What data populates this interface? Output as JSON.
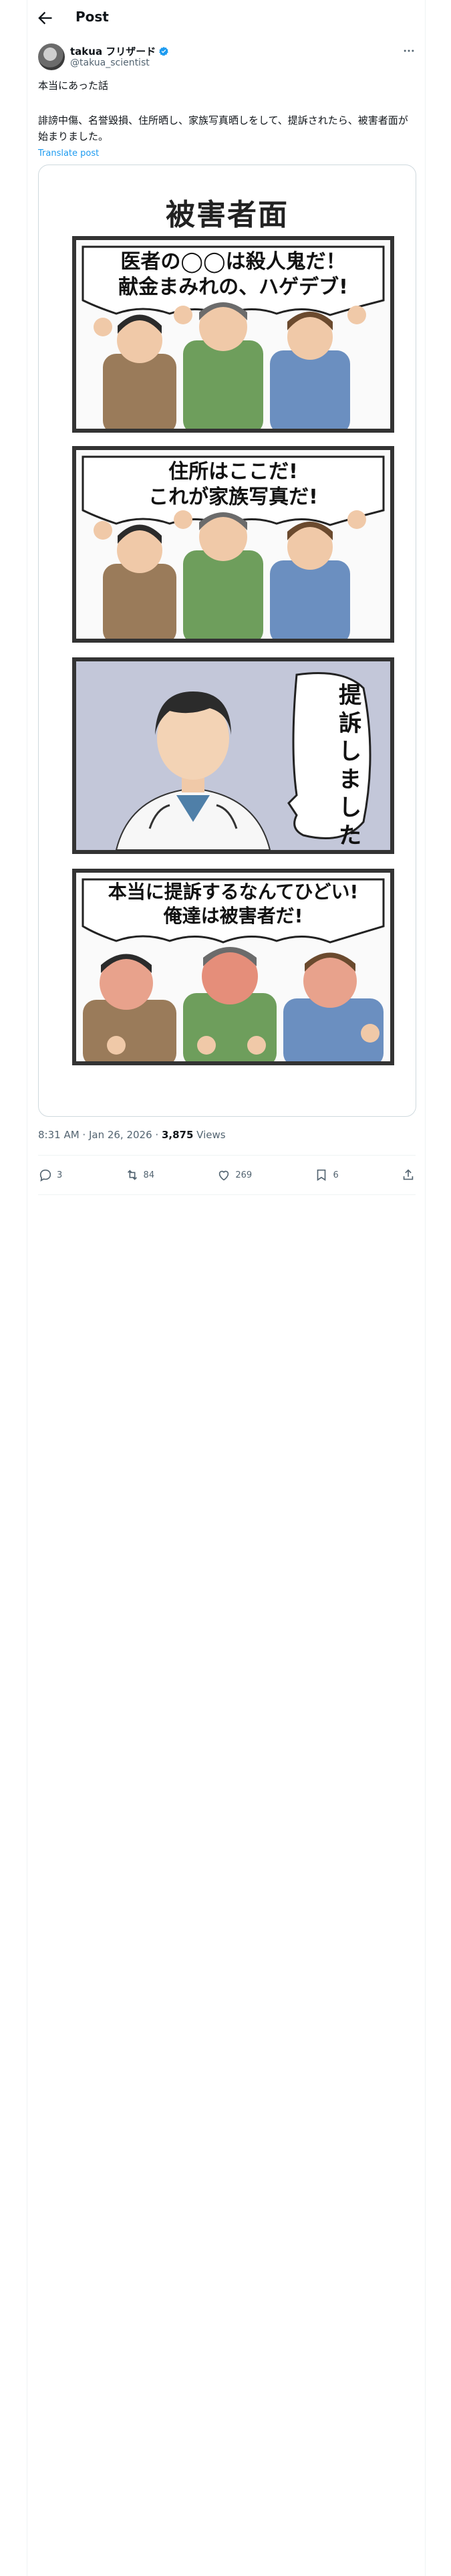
{
  "header": {
    "title": "Post"
  },
  "author": {
    "display_name": "takua フリザード",
    "handle": "@takua_scientist"
  },
  "tweet": {
    "line1": "本当にあった話",
    "line2": "誹謗中傷、名誉毀損、住所晒し、家族写真晒しをして、提訴されたら、被害者面が始まりました。",
    "translate": "Translate post"
  },
  "manga": {
    "title": "被害者面",
    "panel1": {
      "line1": "医者の◯◯は殺人鬼だ！",
      "line2": "献金まみれの、ハゲデブ!"
    },
    "panel2": {
      "line1": "住所はここだ!",
      "line2": "これが家族写真だ!"
    },
    "panel3": {
      "vertical": "提訴しました"
    },
    "panel4": {
      "line1": "本当に提訴するなんてひどい!",
      "line2": "俺達は被害者だ!"
    }
  },
  "meta": {
    "time": "8:31 AM · Jan 26, 2026 · ",
    "views_count": "3,875",
    "views_label": " Views"
  },
  "actions": {
    "replies": "3",
    "reposts": "84",
    "likes": "269",
    "bookmarks": "6"
  },
  "colors": {
    "accent": "#1d9bf0",
    "muted": "#536471"
  },
  "icons": [
    "back-arrow-icon",
    "verified-badge-icon",
    "more-icon",
    "reply-icon",
    "repost-icon",
    "like-icon",
    "bookmark-icon",
    "share-icon"
  ]
}
